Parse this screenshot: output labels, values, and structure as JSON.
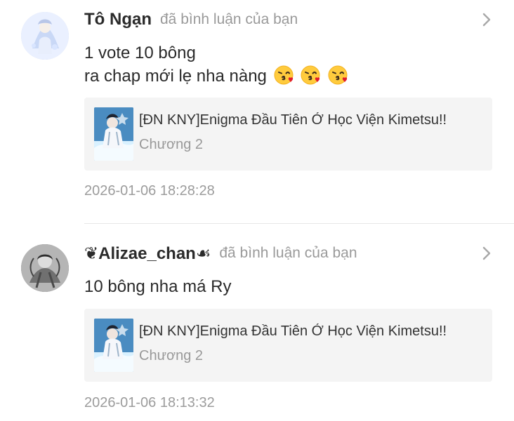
{
  "notifications": [
    {
      "username": "Tô Ngạn",
      "action": "đã bình luận của bạn",
      "comment_lines": [
        "1 vote 10 bông",
        "ra chap mới lẹ nha nàng"
      ],
      "reaction_icons": [
        "kiss-emoji-icon",
        "kiss-emoji-icon",
        "kiss-emoji-icon"
      ],
      "story_title": "[ĐN KNY]Enigma Đầu Tiên Ở Học Viện Kimetsu!!",
      "chapter": "Chương 2",
      "timestamp": "2026-01-06 18:28:28"
    },
    {
      "username": "❦Alizae_chan☙",
      "action": "đã bình luận của bạn",
      "comment_lines": [
        "10 bông nha má Ry"
      ],
      "story_title": "[ĐN KNY]Enigma Đầu Tiên Ở Học Viện Kimetsu!!",
      "chapter": "Chương 2",
      "timestamp": "2026-01-06 18:13:32"
    }
  ],
  "icons": {
    "chevron": "chevron-right-icon",
    "avatar_1": "avatar-image",
    "avatar_2": "avatar-image",
    "story_cover": "story-cover-image"
  },
  "colors": {
    "background": "#ffffff",
    "card_background": "#f4f4f4",
    "primary_text": "#2a2a2a",
    "secondary_text": "#9a9a9a",
    "divider": "#e7e7e7"
  }
}
